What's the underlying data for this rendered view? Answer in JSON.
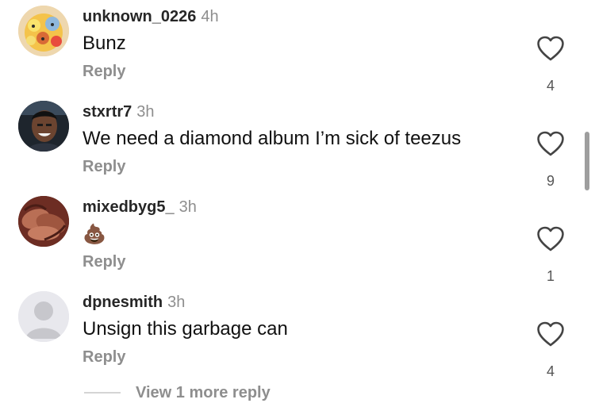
{
  "comments": [
    {
      "username": "unknown_0226",
      "time": "4h",
      "text": "Bunz",
      "reply_label": "Reply",
      "likes": "4",
      "avatar_icon": "cartoon-family-avatar"
    },
    {
      "username": "stxrtr7",
      "time": "3h",
      "text": "We need a diamond album I’m sick of teezus",
      "reply_label": "Reply",
      "likes": "9",
      "avatar_icon": "person-photo-avatar"
    },
    {
      "username": "mixedbyg5_",
      "time": "3h",
      "text": "💩",
      "reply_label": "Reply",
      "likes": "1",
      "avatar_icon": "hands-photo-avatar"
    },
    {
      "username": "dpnesmith",
      "time": "3h",
      "text": "Unsign this garbage can",
      "reply_label": "Reply",
      "likes": "4",
      "avatar_icon": "default-person-avatar"
    }
  ],
  "view_more_label": "View 1 more reply",
  "icons": {
    "like": "heart-outline-icon"
  },
  "colors": {
    "secondary_text": "#8e8e8e",
    "primary_text": "#111111",
    "placeholder_avatar": "#c7c7cc"
  }
}
